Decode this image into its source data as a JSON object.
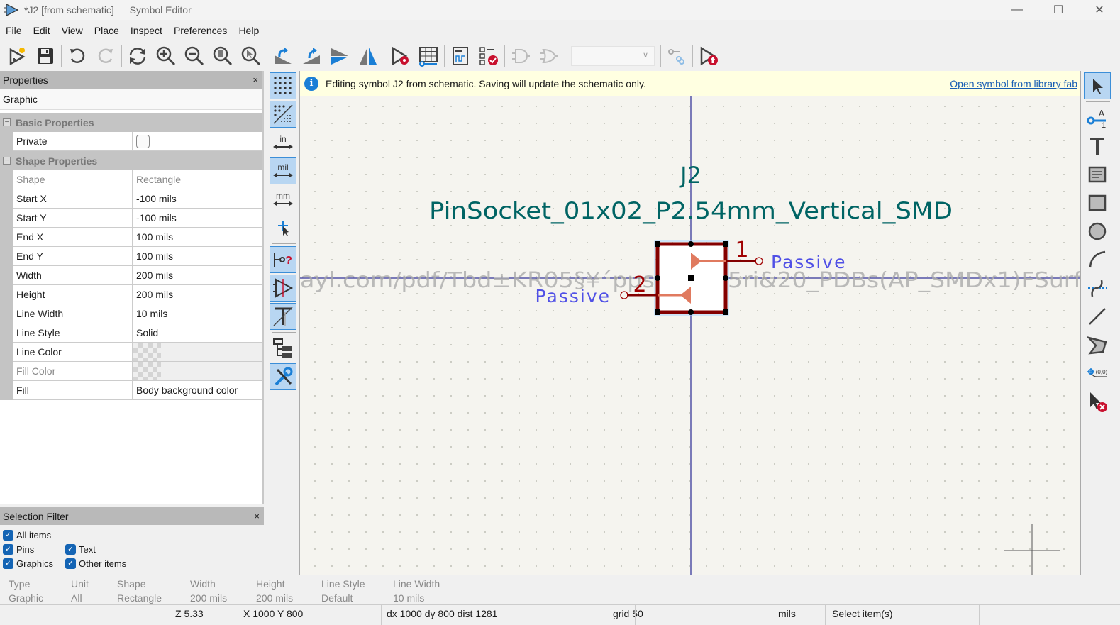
{
  "window": {
    "title": "*J2 [from schematic] — Symbol Editor",
    "controls": {
      "minimize": "—",
      "maximize": "☐",
      "close": "✕"
    }
  },
  "menu": [
    "File",
    "Edit",
    "View",
    "Place",
    "Inspect",
    "Preferences",
    "Help"
  ],
  "toolbar": {
    "icons": [
      "new-symbol-icon",
      "save-icon",
      "undo-icon",
      "redo-icon",
      "refresh-icon",
      "zoom-in-icon",
      "zoom-out-icon",
      "zoom-fit-icon",
      "zoom-selection-icon",
      "rotate-ccw-icon",
      "rotate-cw-icon",
      "mirror-vertical-icon",
      "mirror-horizontal-icon",
      "symbol-properties-icon",
      "pin-table-icon",
      "datasheet-icon",
      "symbol-checker-icon",
      "unit-deMorgan-standard-icon",
      "unit-deMorgan-alternate-icon",
      "unit-selector",
      "pin-link-icon",
      "update-symbol-icon"
    ],
    "unit_selector_value": ""
  },
  "properties_panel": {
    "title": "Properties",
    "close": "×",
    "item_type": "Graphic",
    "sections": [
      {
        "name": "Basic Properties",
        "toggle": "−",
        "rows": [
          {
            "key": "Private",
            "value": "",
            "kind": "checkbox",
            "checked": false
          }
        ]
      },
      {
        "name": "Shape Properties",
        "toggle": "−",
        "rows": [
          {
            "key": "Shape",
            "value": "Rectangle",
            "kind": "disabled"
          },
          {
            "key": "Start X",
            "value": "-100 mils"
          },
          {
            "key": "Start Y",
            "value": "-100 mils"
          },
          {
            "key": "End X",
            "value": "100 mils"
          },
          {
            "key": "End Y",
            "value": "100 mils"
          },
          {
            "key": "Width",
            "value": "200 mils"
          },
          {
            "key": "Height",
            "value": "200 mils"
          },
          {
            "key": "Line Width",
            "value": "10 mils"
          },
          {
            "key": "Line Style",
            "value": "Solid"
          },
          {
            "key": "Line Color",
            "value": "",
            "kind": "color"
          },
          {
            "key": "Fill Color",
            "value": "",
            "kind": "color-disabled"
          },
          {
            "key": "Fill",
            "value": "Body background color"
          }
        ]
      }
    ]
  },
  "selection_filter": {
    "title": "Selection Filter",
    "close": "×",
    "items": [
      {
        "label": "All items",
        "checked": true
      },
      {
        "label": "Pins",
        "checked": true
      },
      {
        "label": "Text",
        "checked": true
      },
      {
        "label": "Graphics",
        "checked": true
      },
      {
        "label": "Other items",
        "checked": true
      }
    ]
  },
  "left_toolbar": [
    "grid-dots-icon",
    "grid-overrides-icon",
    "units-inches-icon",
    "units-mils-icon",
    "units-mm-icon",
    "full-crosshair-icon",
    "show-pin-electrical-type-icon",
    "show-hidden-pins-icon",
    "show-hidden-fields-icon",
    "symbol-tree-icon",
    "properties-manager-icon"
  ],
  "left_toolbar_labels": {
    "in": "in",
    "mil": "mil",
    "mm": "mm"
  },
  "right_toolbar": [
    "select-icon",
    "add-pin-icon",
    "add-text-icon",
    "add-textbox-icon",
    "add-rectangle-icon",
    "add-circle-icon",
    "add-arc-icon",
    "add-bezier-icon",
    "add-line-icon",
    "add-polygon-icon",
    "anchor-icon",
    "delete-tool-icon"
  ],
  "infobar": {
    "message": "Editing symbol J2 from schematic.  Saving will update the schematic only.",
    "link": "Open symbol from library fab"
  },
  "canvas": {
    "reference": "J2",
    "value": "PinSocket_01x02_P2.54mm_Vertical_SMD",
    "pins": [
      {
        "number": "1",
        "type": "Passive"
      },
      {
        "number": "2",
        "type": "Passive"
      }
    ],
    "hidden_field_left": "ayl.com/pdf/Tbd±KR05§¥´pµs",
    "hidden_field_right": "5ri&20_PDBs(AP_SMDx1)FSurf",
    "colors": {
      "body_outline": "#840000",
      "pin": "#e07a5f",
      "pin_line": "#840000",
      "pin_number": "#a00000",
      "pin_type": "#5050e6",
      "fields": "#006464",
      "axis": "#000080",
      "hidden_text": "#aaaaaa"
    }
  },
  "message_panel": [
    {
      "label": "Type",
      "value": "Graphic"
    },
    {
      "label": "Unit",
      "value": "All"
    },
    {
      "label": "Shape",
      "value": "Rectangle"
    },
    {
      "label": "Width",
      "value": "200 mils"
    },
    {
      "label": "Height",
      "value": "200 mils"
    },
    {
      "label": "Line Style",
      "value": "Default"
    },
    {
      "label": "Line Width",
      "value": "10 mils"
    }
  ],
  "status_bar": {
    "zoom": "Z 5.33",
    "cursor": "X 1000  Y 800",
    "delta": "dx 1000  dy 800  dist 1281",
    "grid": "grid 50",
    "units": "mils",
    "mode": "Select item(s)"
  }
}
